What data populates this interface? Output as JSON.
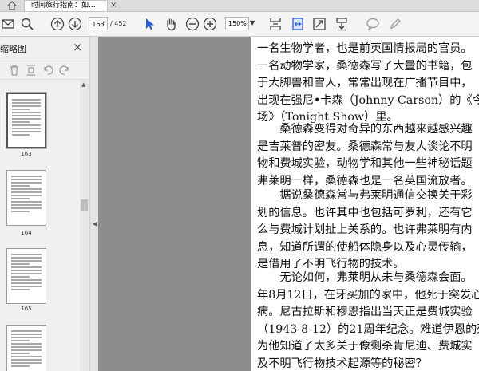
{
  "tabs": {
    "active_label": "时间旅行指南：如...",
    "close_glyph": "×"
  },
  "toolbar": {
    "page_current": "163",
    "page_total": "/ 452",
    "zoom": "150%",
    "zoom_arrow": "▼"
  },
  "panel": {
    "title": "缩略图",
    "close_glyph": "×",
    "thumbnails": [
      {
        "label": "163",
        "selected": true
      },
      {
        "label": "164",
        "selected": false
      },
      {
        "label": "165",
        "selected": false
      },
      {
        "label": "",
        "selected": false
      }
    ]
  },
  "document": {
    "paragraphs": [
      [
        "一名生物学者，也是前英国情报局的官员。",
        "一名动物学家，桑德森写了大量的书籍，包",
        "于大脚兽和雪人，常常出现在广播节目中，",
        "出现在强尼•卡森（Johnny Carson）的《今夜",
        "场》（Tonight Show）里。"
      ],
      [
        "　　桑德森变得对奇异的东西越来越感兴趣",
        "是吉莱普的密友。桑德森常与友人谈论不明",
        "物和费城实验，动物学和其他一些神秘话题",
        "弗莱明一样，桑德森也是一名英国流放者。"
      ],
      [
        "　　据说桑德森常与弗莱明通信交换关于彩",
        "划的信息。也许其中也包括可罗利，还有它",
        "么与费城计划扯上关系的。也许弗莱明有内",
        "息，知道所谓的使船体隐身以及心灵传输，",
        "是借用了不明飞行物的技术。"
      ],
      [
        "　　无论如何，弗莱明从未与桑德森会面。",
        "年8月12日，在牙买加的家中，他死于突发心",
        "病。尼古拉斯和穆恩指出当天正是费城实验",
        "（1943-8-12）的21周年纪念。难道伊恩的死",
        "为他知道了太多关于像剩杀肯尼迪、费城实",
        "及不明飞行物技术起源等的秘密？"
      ]
    ]
  }
}
